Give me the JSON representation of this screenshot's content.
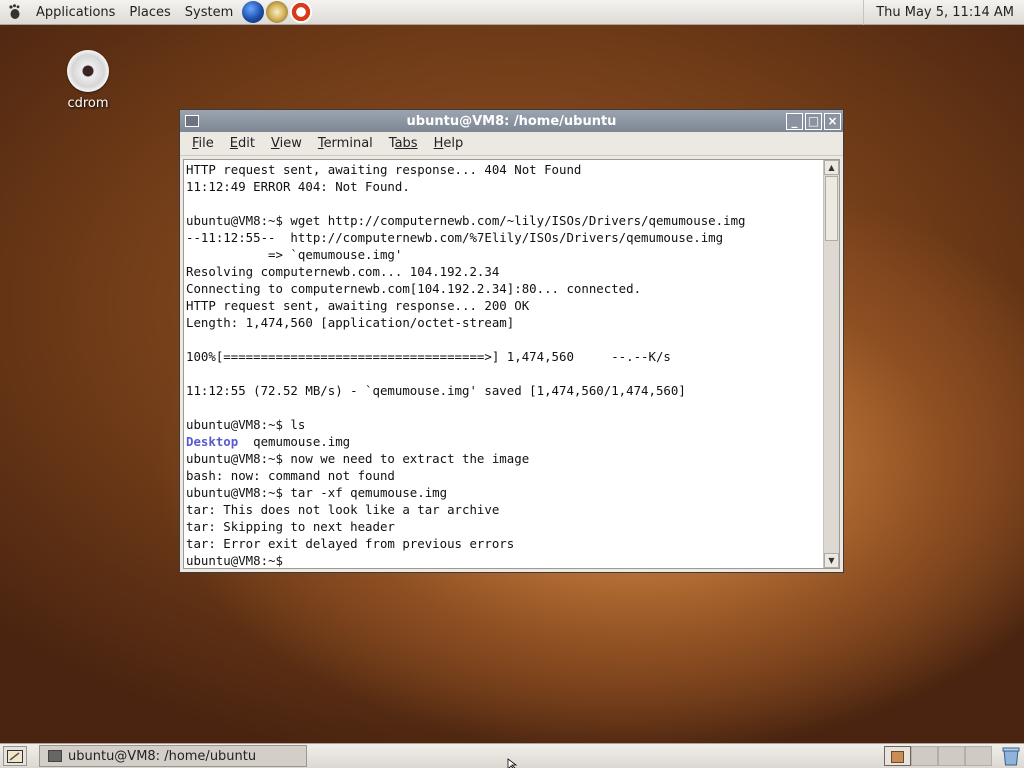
{
  "top_panel": {
    "menus": [
      "Applications",
      "Places",
      "System"
    ],
    "launchers": [
      "web-browser-icon",
      "mail-icon",
      "help-icon"
    ],
    "clock": "Thu May  5, 11:14 AM"
  },
  "desktop": {
    "icons": [
      {
        "label": "cdrom",
        "icon": "cdrom-icon"
      }
    ]
  },
  "terminal": {
    "title": "ubuntu@VM8: /home/ubuntu",
    "menubar": [
      {
        "label": "File",
        "accel": "F",
        "rest": "ile"
      },
      {
        "label": "Edit",
        "accel": "E",
        "rest": "dit"
      },
      {
        "label": "View",
        "accel": "V",
        "rest": "iew"
      },
      {
        "label": "Terminal",
        "accel": "T",
        "rest": "erminal"
      },
      {
        "label": "Tabs",
        "accel": "T",
        "rest": "abs"
      },
      {
        "label": "Help",
        "accel": "H",
        "rest": "elp"
      }
    ],
    "lines": [
      "HTTP request sent, awaiting response... 404 Not Found",
      "11:12:49 ERROR 404: Not Found.",
      "",
      "ubuntu@VM8:~$ wget http://computernewb.com/~lily/ISOs/Drivers/qemumouse.img",
      "--11:12:55--  http://computernewb.com/%7Elily/ISOs/Drivers/qemumouse.img",
      "           => `qemumouse.img'",
      "Resolving computernewb.com... 104.192.2.34",
      "Connecting to computernewb.com[104.192.2.34]:80... connected.",
      "HTTP request sent, awaiting response... 200 OK",
      "Length: 1,474,560 [application/octet-stream]",
      "",
      "100%[===================================>] 1,474,560     --.--K/s",
      "",
      "11:12:55 (72.52 MB/s) - `qemumouse.img' saved [1,474,560/1,474,560]",
      "",
      "ubuntu@VM8:~$ ls",
      {
        "highlight": "Desktop",
        "rest": "  qemumouse.img"
      },
      "ubuntu@VM8:~$ now we need to extract the image",
      "bash: now: command not found",
      "ubuntu@VM8:~$ tar -xf qemumouse.img",
      "tar: This does not look like a tar archive",
      "tar: Skipping to next header",
      "tar: Error exit delayed from previous errors",
      "ubuntu@VM8:~$ "
    ]
  },
  "bottom_panel": {
    "task_button": "ubuntu@VM8: /home/ubuntu",
    "workspaces": 4,
    "active_workspace": 1
  }
}
